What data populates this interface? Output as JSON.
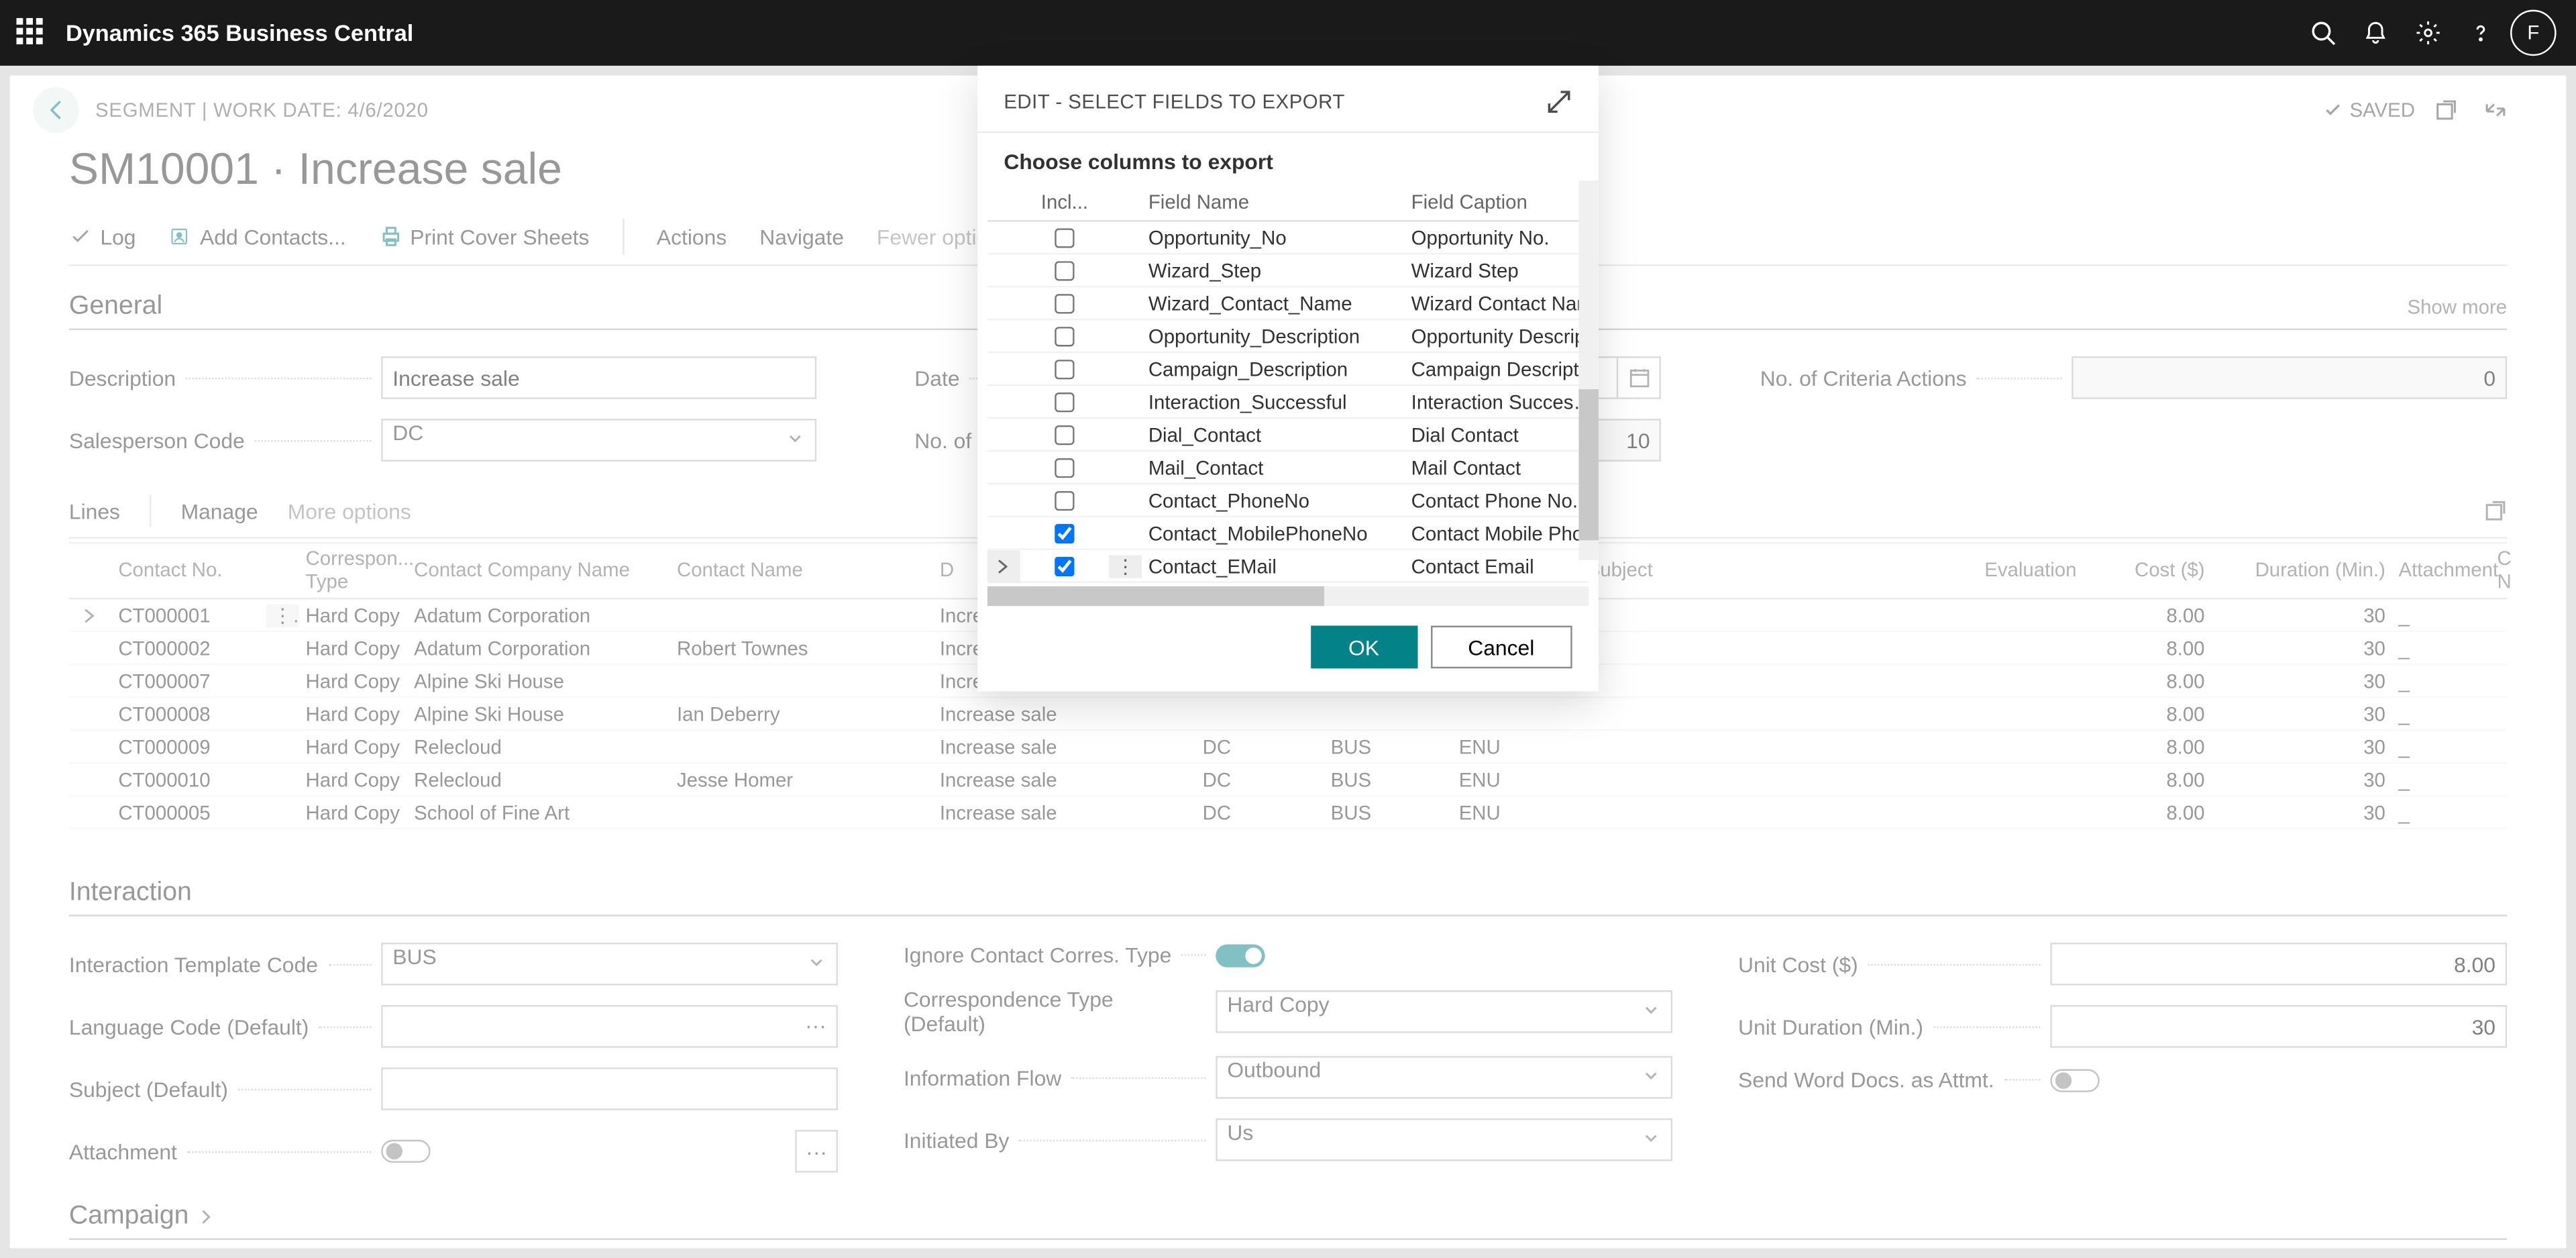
{
  "topbar": {
    "product": "Dynamics 365 Business Central",
    "avatar_initial": "F"
  },
  "crumb": {
    "segment_label": "SEGMENT",
    "workdate_label": "WORK DATE:",
    "workdate": "4/6/2020",
    "saved": "SAVED"
  },
  "page_title": "SM10001 · Increase sale",
  "cmdbar": {
    "log": "Log",
    "add_contacts": "Add Contacts...",
    "print_cover": "Print Cover Sheets",
    "actions": "Actions",
    "navigate": "Navigate",
    "fewer": "Fewer options"
  },
  "general": {
    "heading": "General",
    "showmore": "Show more",
    "description_label": "Description",
    "description": "Increase sale",
    "salesperson_label": "Salesperson Code",
    "salesperson": "DC",
    "date_label": "Date",
    "date": "",
    "lines_label": "No. of Li",
    "lines_value": "10",
    "criteria_label": "No. of Criteria Actions",
    "criteria_value": "0"
  },
  "lines": {
    "tab": "Lines",
    "manage": "Manage",
    "more": "More options",
    "cols": {
      "contact_no": "Contact No.",
      "corr": "Correspon... Type",
      "company": "Contact Company Name",
      "cname": "Contact Name",
      "desc": "D",
      "sal": "",
      "intc": "",
      "lang": "",
      "subj": "Subject",
      "eval": "Evaluation",
      "cost": "Cost ($)",
      "dur": "Duration (Min.)",
      "att": "Attachment",
      "cno2": "C N"
    },
    "rows": [
      {
        "no": "CT000001",
        "corr": "Hard Copy",
        "company": "Adatum Corporation",
        "cname": "",
        "desc": "Increase sale",
        "sal": "",
        "intc": "",
        "lang": "",
        "subj": "",
        "eval": "",
        "cost": "8.00",
        "dur": "30",
        "att": "_"
      },
      {
        "no": "CT000002",
        "corr": "Hard Copy",
        "company": "Adatum Corporation",
        "cname": "Robert Townes",
        "desc": "Increase sale",
        "sal": "",
        "intc": "",
        "lang": "",
        "subj": "",
        "eval": "",
        "cost": "8.00",
        "dur": "30",
        "att": "_"
      },
      {
        "no": "CT000007",
        "corr": "Hard Copy",
        "company": "Alpine Ski House",
        "cname": "",
        "desc": "Increase sale",
        "sal": "",
        "intc": "",
        "lang": "",
        "subj": "",
        "eval": "",
        "cost": "8.00",
        "dur": "30",
        "att": "_"
      },
      {
        "no": "CT000008",
        "corr": "Hard Copy",
        "company": "Alpine Ski House",
        "cname": "Ian Deberry",
        "desc": "Increase sale",
        "sal": "",
        "intc": "",
        "lang": "",
        "subj": "",
        "eval": "",
        "cost": "8.00",
        "dur": "30",
        "att": "_"
      },
      {
        "no": "CT000009",
        "corr": "Hard Copy",
        "company": "Relecloud",
        "cname": "",
        "desc": "Increase sale",
        "sal": "DC",
        "intc": "BUS",
        "lang": "ENU",
        "subj": "",
        "eval": "",
        "cost": "8.00",
        "dur": "30",
        "att": "_"
      },
      {
        "no": "CT000010",
        "corr": "Hard Copy",
        "company": "Relecloud",
        "cname": "Jesse Homer",
        "desc": "Increase sale",
        "sal": "DC",
        "intc": "BUS",
        "lang": "ENU",
        "subj": "",
        "eval": "",
        "cost": "8.00",
        "dur": "30",
        "att": "_"
      },
      {
        "no": "CT000005",
        "corr": "Hard Copy",
        "company": "School of Fine Art",
        "cname": "",
        "desc": "Increase sale",
        "sal": "DC",
        "intc": "BUS",
        "lang": "ENU",
        "subj": "",
        "eval": "",
        "cost": "8.00",
        "dur": "30",
        "att": "_"
      }
    ]
  },
  "interaction": {
    "heading": "Interaction",
    "tmpl_label": "Interaction Template Code",
    "tmpl": "BUS",
    "langlabel": "Language Code (Default)",
    "lang": "",
    "subjlabel": "Subject (Default)",
    "subj": "",
    "attlabel": "Attachment",
    "ignore_label": "Ignore Contact Corres. Type",
    "corrdeflabel": "Correspondence Type (Default)",
    "corrdef": "Hard Copy",
    "infoflow_label": "Information Flow",
    "infoflow": "Outbound",
    "initby_label": "Initiated By",
    "initby": "Us",
    "unitcost_label": "Unit Cost ($)",
    "unitcost": "8.00",
    "unitdur_label": "Unit Duration (Min.)",
    "unitdur": "30",
    "sendword_label": "Send Word Docs. as Attmt."
  },
  "campaign": {
    "heading": "Campaign"
  },
  "modal": {
    "title": "EDIT - SELECT FIELDS TO EXPORT",
    "subtitle": "Choose columns to export",
    "cols": {
      "incl": "Incl...",
      "fname": "Field Name",
      "fcap": "Field Caption"
    },
    "rows": [
      {
        "checked": false,
        "fname": "Opportunity_No",
        "fcap": "Opportunity No."
      },
      {
        "checked": false,
        "fname": "Wizard_Step",
        "fcap": "Wizard Step"
      },
      {
        "checked": false,
        "fname": "Wizard_Contact_Name",
        "fcap": "Wizard Contact Nam"
      },
      {
        "checked": false,
        "fname": "Opportunity_Description",
        "fcap": "Opportunity Descrip"
      },
      {
        "checked": false,
        "fname": "Campaign_Description",
        "fcap": "Campaign Descriptic"
      },
      {
        "checked": false,
        "fname": "Interaction_Successful",
        "fcap": "Interaction Successfu"
      },
      {
        "checked": false,
        "fname": "Dial_Contact",
        "fcap": "Dial Contact"
      },
      {
        "checked": false,
        "fname": "Mail_Contact",
        "fcap": "Mail Contact"
      },
      {
        "checked": false,
        "fname": "Contact_PhoneNo",
        "fcap": "Contact Phone No."
      },
      {
        "checked": true,
        "fname": "Contact_MobilePhoneNo",
        "fcap": "Contact Mobile Phon"
      },
      {
        "checked": true,
        "fname": "Contact_EMail",
        "fcap": "Contact Email",
        "active": true
      }
    ],
    "ok": "OK",
    "cancel": "Cancel"
  }
}
